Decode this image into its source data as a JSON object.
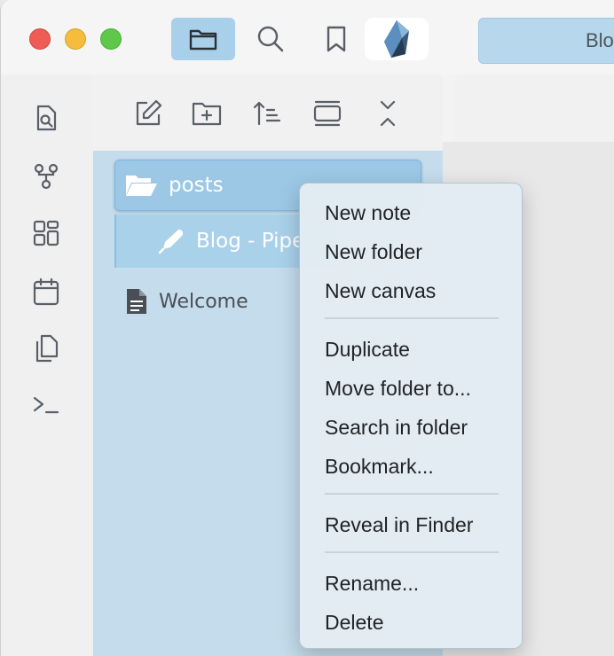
{
  "window": {
    "traffic_lights": [
      "close",
      "minimize",
      "zoom"
    ]
  },
  "titlebar": {
    "buttons": [
      {
        "icon": "folder-icon",
        "active": true
      },
      {
        "icon": "search-icon",
        "active": false
      },
      {
        "icon": "bookmark-icon",
        "active": false
      }
    ],
    "logo": "obsidian-logo-icon",
    "tab_label": "Blog - Pipe"
  },
  "ribbon": {
    "icons": [
      "quick-switcher-icon",
      "graph-view-icon",
      "canvas-icon",
      "daily-note-icon",
      "templates-icon",
      "command-palette-icon"
    ]
  },
  "explorer": {
    "toolbar": [
      "new-note-icon",
      "new-folder-icon",
      "sort-icon",
      "collapse-view-icon",
      "collapse-all-icon"
    ],
    "items": [
      {
        "label": "posts",
        "icon": "open-folder-icon"
      },
      {
        "label": "Blog - Pipe",
        "icon": "pen-icon"
      },
      {
        "label": "Welcome",
        "icon": "document-icon"
      }
    ]
  },
  "context_menu": {
    "groups": [
      [
        "New note",
        "New folder",
        "New canvas"
      ],
      [
        "Duplicate",
        "Move folder to...",
        "Search in folder",
        "Bookmark..."
      ],
      [
        "Reveal in Finder"
      ],
      [
        "Rename...",
        "Delete"
      ]
    ]
  },
  "colors": {
    "accent": "#a8d0ea",
    "sidebar": "#c4dceb",
    "selected": "#9cc8e5"
  }
}
